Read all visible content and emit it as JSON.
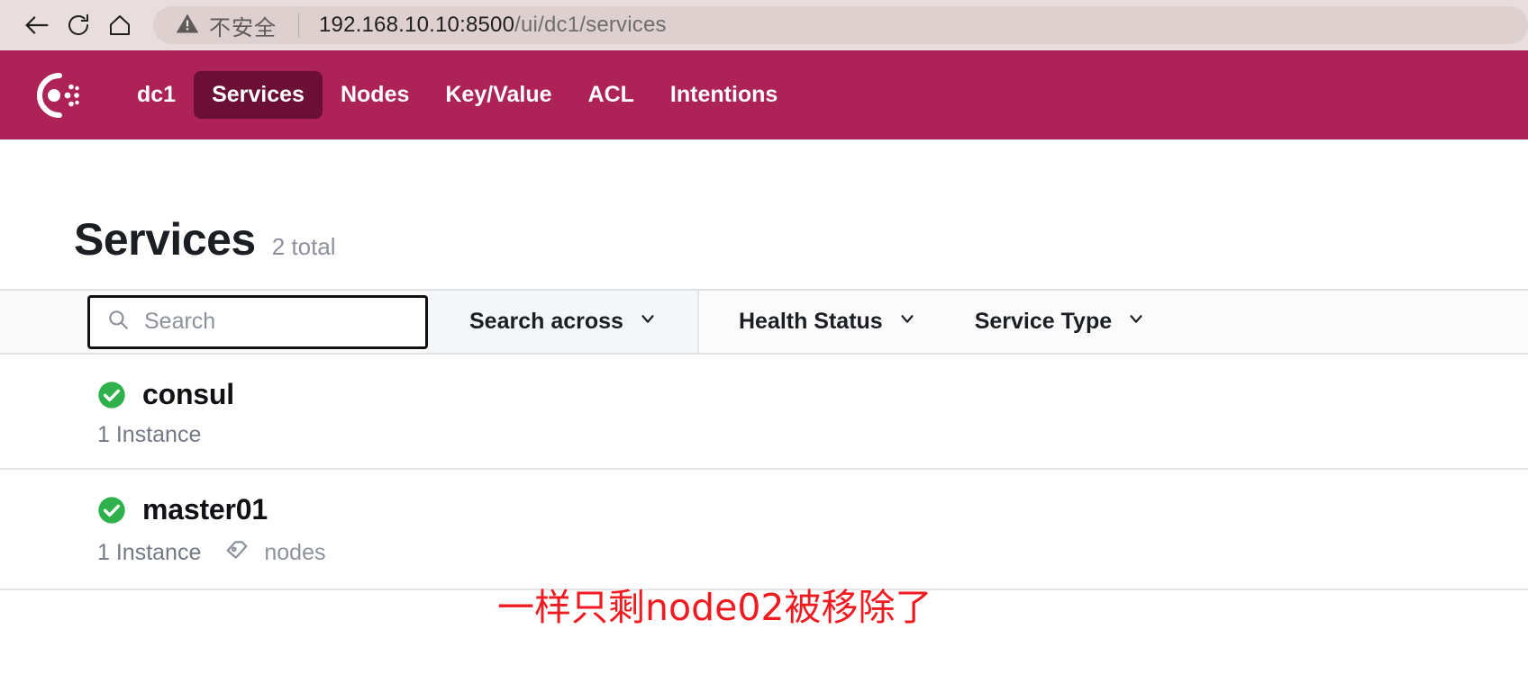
{
  "browser": {
    "back_icon": "back-arrow-icon",
    "reload_icon": "reload-icon",
    "home_icon": "home-icon",
    "security": {
      "icon": "warning-triangle-icon",
      "label": "不安全"
    },
    "url_host": "192.168.10.10:8500",
    "url_path": "/ui/dc1/services"
  },
  "nav": {
    "logo_icon": "consul-logo-icon",
    "datacenter": "dc1",
    "items": [
      {
        "label": "Services",
        "active": true
      },
      {
        "label": "Nodes",
        "active": false
      },
      {
        "label": "Key/Value",
        "active": false
      },
      {
        "label": "ACL",
        "active": false
      },
      {
        "label": "Intentions",
        "active": false
      }
    ],
    "background": "#ad2257",
    "active_background": "#6b0f36"
  },
  "page": {
    "title": "Services",
    "total": "2 total"
  },
  "filters": {
    "search": {
      "icon": "search-icon",
      "value": "",
      "placeholder": "Search"
    },
    "dropdowns": [
      {
        "label": "Search across",
        "icon": "chevron-down-icon"
      },
      {
        "label": "Health Status",
        "icon": "chevron-down-icon"
      },
      {
        "label": "Service Type",
        "icon": "chevron-down-icon"
      }
    ]
  },
  "services": [
    {
      "name": "consul",
      "status_icon": "health-passing-icon",
      "status_color": "#2eb14a",
      "instances": "1 Instance",
      "tag": null,
      "tag_icon": null
    },
    {
      "name": "master01",
      "status_icon": "health-passing-icon",
      "status_color": "#2eb14a",
      "instances": "1 Instance",
      "tag": "nodes",
      "tag_icon": "tag-icon"
    }
  ],
  "annotation": {
    "text": "一样只剩node02被移除了",
    "color": "#ee1c20"
  }
}
